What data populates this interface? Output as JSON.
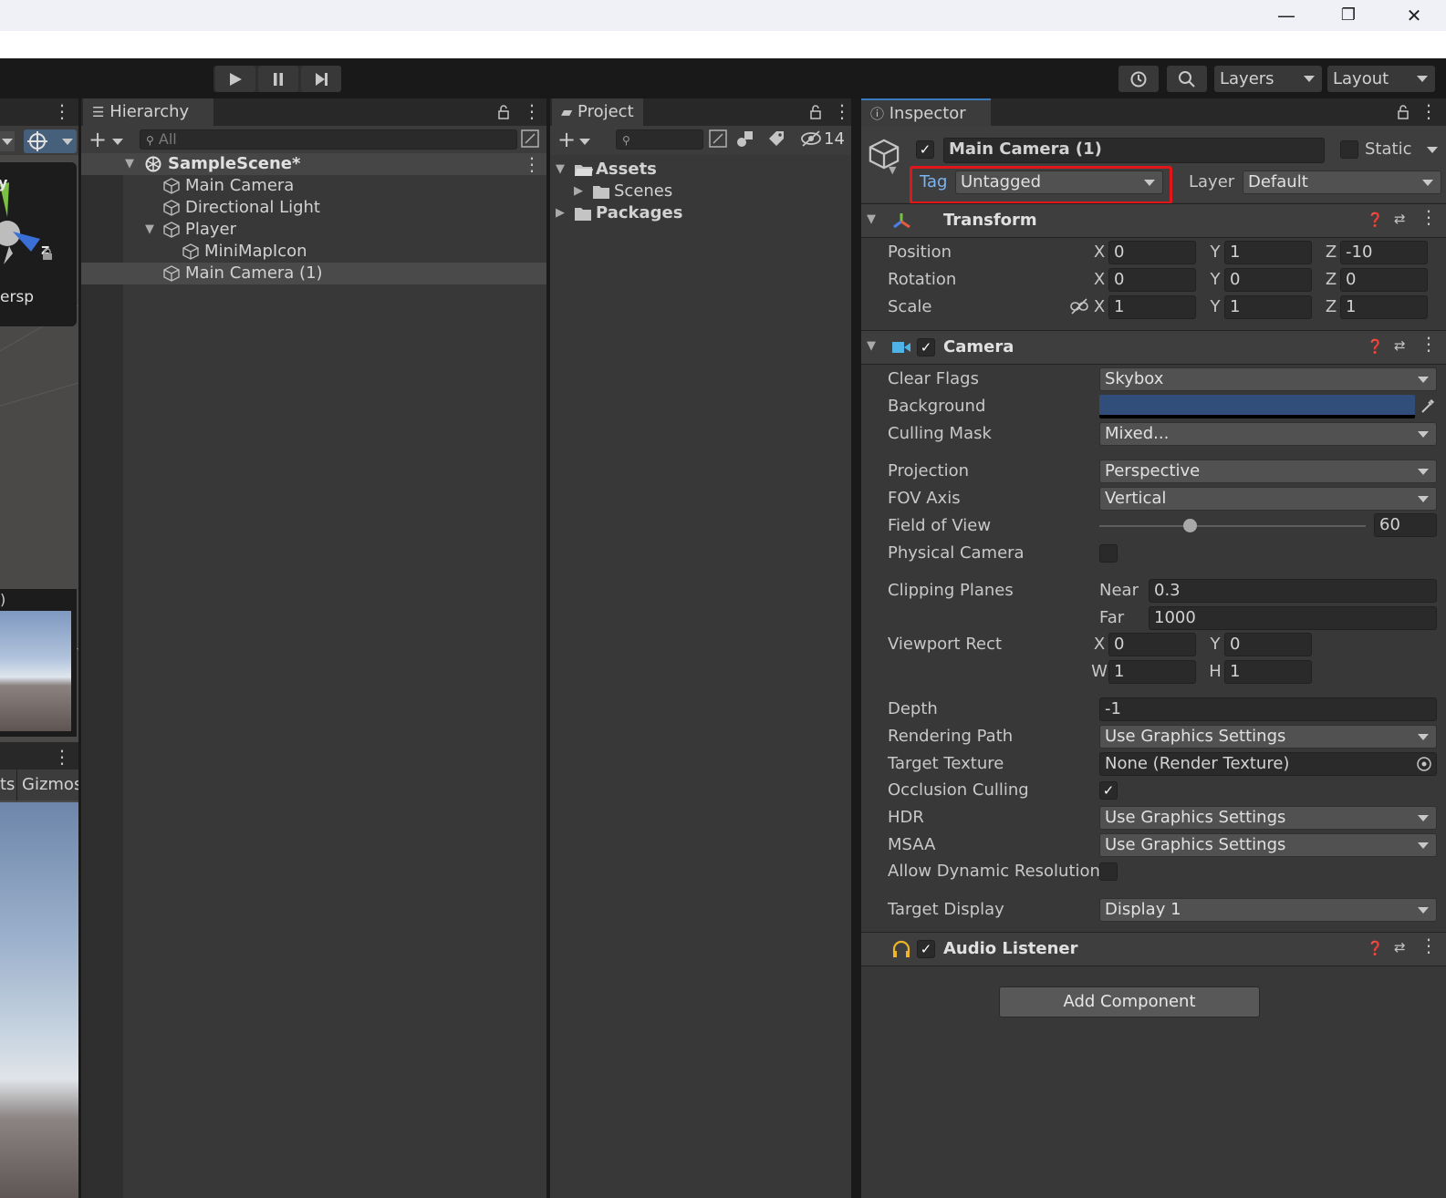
{
  "window": {
    "minimize_glyph": "—",
    "maximize_glyph": "❐",
    "close_glyph": "✕"
  },
  "toolbar": {
    "play_icon": "play-icon",
    "pause_icon": "pause-icon",
    "step_icon": "step-icon",
    "layers_label": "Layers",
    "layout_label": "Layout"
  },
  "scene_view": {
    "gizmo_axis": "z",
    "gizmo_y": "y",
    "persp_label": "ersp",
    "paren": ")",
    "game_tab_fragment": "ts",
    "gizmos_label": "Gizmos"
  },
  "hierarchy": {
    "tab_label": "Hierarchy",
    "search_placeholder": "All",
    "scene_name": "SampleScene*",
    "items": [
      {
        "label": "Main Camera"
      },
      {
        "label": "Directional Light"
      },
      {
        "label": "Player"
      },
      {
        "label": "MiniMapIcon"
      },
      {
        "label": "Main Camera (1)"
      }
    ]
  },
  "project": {
    "tab_label": "Project",
    "hidden_count": "14",
    "tree": [
      {
        "label": "Assets"
      },
      {
        "label": "Scenes"
      },
      {
        "label": "Packages"
      }
    ]
  },
  "inspector": {
    "tab_label": "Inspector",
    "object_name": "Main Camera (1)",
    "static_label": "Static",
    "tag_label": "Tag",
    "tag_value": "Untagged",
    "layer_label": "Layer",
    "layer_value": "Default",
    "highlight_color": "#e0161a",
    "transform": {
      "title": "Transform",
      "position_label": "Position",
      "rotation_label": "Rotation",
      "scale_label": "Scale",
      "position": {
        "x": "0",
        "y": "1",
        "z": "-10"
      },
      "rotation": {
        "x": "0",
        "y": "0",
        "z": "0"
      },
      "scale": {
        "x": "1",
        "y": "1",
        "z": "1"
      }
    },
    "camera": {
      "title": "Camera",
      "clear_flags_label": "Clear Flags",
      "clear_flags_value": "Skybox",
      "background_label": "Background",
      "background_color": "#314d79",
      "culling_mask_label": "Culling Mask",
      "culling_mask_value": "Mixed...",
      "projection_label": "Projection",
      "projection_value": "Perspective",
      "fov_axis_label": "FOV Axis",
      "fov_axis_value": "Vertical",
      "fov_label": "Field of View",
      "fov_value": "60",
      "fov_slider_fraction": 0.34,
      "physical_camera_label": "Physical Camera",
      "clipping_label": "Clipping Planes",
      "near_label": "Near",
      "near_value": "0.3",
      "far_label": "Far",
      "far_value": "1000",
      "viewport_label": "Viewport Rect",
      "vp": {
        "x": "0",
        "y": "0",
        "w": "1",
        "h": "1"
      },
      "vp_labels": {
        "x": "X",
        "y": "Y",
        "w": "W",
        "h": "H"
      },
      "depth_label": "Depth",
      "depth_value": "-1",
      "rendering_path_label": "Rendering Path",
      "rendering_path_value": "Use Graphics Settings",
      "target_texture_label": "Target Texture",
      "target_texture_value": "None (Render Texture)",
      "occlusion_label": "Occlusion Culling",
      "hdr_label": "HDR",
      "hdr_value": "Use Graphics Settings",
      "msaa_label": "MSAA",
      "msaa_value": "Use Graphics Settings",
      "dynamic_res_label": "Allow Dynamic Resolution",
      "target_display_label": "Target Display",
      "target_display_value": "Display 1"
    },
    "audio_listener": {
      "title": "Audio Listener"
    },
    "add_component_label": "Add Component",
    "axis_labels": {
      "x": "X",
      "y": "Y",
      "z": "Z"
    }
  }
}
